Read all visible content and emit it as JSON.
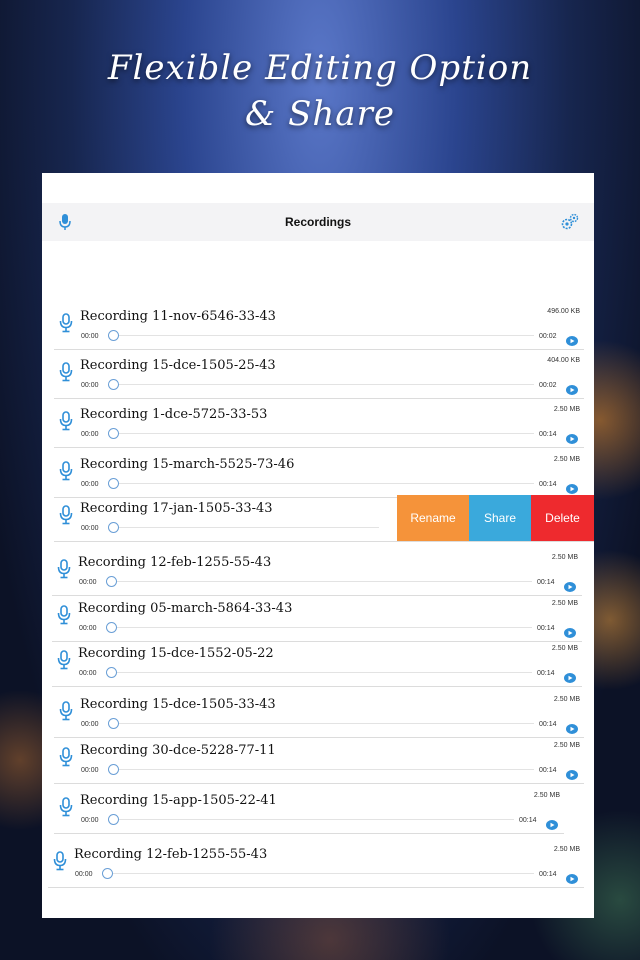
{
  "promo": {
    "headline_line1": "Flexible Editing Option",
    "headline_line2": "& Share"
  },
  "navbar": {
    "title": "Recordings",
    "left_icon": "mic-icon",
    "right_icon": "gear-icon"
  },
  "colors": {
    "accent_blue": "#2f8fd8",
    "rename": "#f5933a",
    "share": "#3aa9dc",
    "delete": "#ee2a2e"
  },
  "swipe_actions": {
    "rename": "Rename",
    "share": "Share",
    "delete": "Delete"
  },
  "recordings": [
    {
      "title": "Recording 11-nov-6546-33-43",
      "start": "00:00",
      "end": "00:02",
      "size": "496.00 KB"
    },
    {
      "title": "Recording 15-dce-1505-25-43",
      "start": "00:00",
      "end": "00:02",
      "size": "404.00 KB"
    },
    {
      "title": "Recording 1-dce-5725-33-53",
      "start": "00:00",
      "end": "00:14",
      "size": "2.50 MB"
    },
    {
      "title": "Recording 15-march-5525-73-46",
      "start": "00:00",
      "end": "00:14",
      "size": "2.50 MB"
    },
    {
      "title": "Recording 17-jan-1505-33-43",
      "start": "00:00",
      "end": "",
      "size": ""
    },
    {
      "title": "Recording 12-feb-1255-55-43",
      "start": "00:00",
      "end": "00:14",
      "size": "2.50 MB"
    },
    {
      "title": "Recording 05-march-5864-33-43",
      "start": "00:00",
      "end": "00:14",
      "size": "2.50 MB"
    },
    {
      "title": "Recording 15-dce-1552-05-22",
      "start": "00:00",
      "end": "00:14",
      "size": "2.50 MB"
    },
    {
      "title": "Recording 15-dce-1505-33-43",
      "start": "00:00",
      "end": "00:14",
      "size": "2.50 MB"
    },
    {
      "title": "Recording 30-dce-5228-77-11",
      "start": "00:00",
      "end": "00:14",
      "size": "2.50 MB"
    },
    {
      "title": "Recording 15-app-1505-22-41",
      "start": "00:00",
      "end": "00:14",
      "size": "2.50 MB"
    },
    {
      "title": "Recording 12-feb-1255-55-43",
      "start": "00:00",
      "end": "00:14",
      "size": "2.50 MB"
    }
  ]
}
